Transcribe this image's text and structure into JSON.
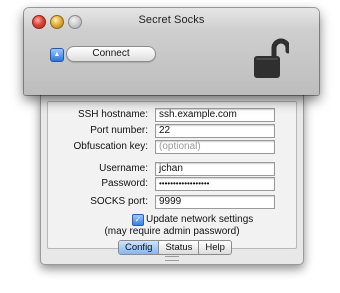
{
  "window": {
    "title": "Secret Socks"
  },
  "toolbar": {
    "connect_label": "Connect",
    "disclosure_glyph": "▲",
    "lock_icon": "unlocked-padlock-icon"
  },
  "form": {
    "ssh_hostname": {
      "label": "SSH hostname:",
      "value": "ssh.example.com"
    },
    "port_number": {
      "label": "Port number:",
      "value": "22"
    },
    "obfuscation_key": {
      "label": "Obfuscation key:",
      "placeholder": "(optional)"
    },
    "username": {
      "label": "Username:",
      "value": "jchan"
    },
    "password": {
      "label": "Password:",
      "value": "••••••••••••••••••"
    },
    "socks_port": {
      "label": "SOCKS port:",
      "value": "9999"
    },
    "update_network": {
      "checked": true,
      "check_glyph": "✓",
      "label": "Update network settings",
      "note": "(may require admin password)"
    }
  },
  "tabs": [
    {
      "label": "Config",
      "active": true
    },
    {
      "label": "Status",
      "active": false
    },
    {
      "label": "Help",
      "active": false
    }
  ],
  "colors": {
    "accent": "#3a7fe6",
    "close": "#e2453a",
    "minimize": "#e5b23a"
  }
}
